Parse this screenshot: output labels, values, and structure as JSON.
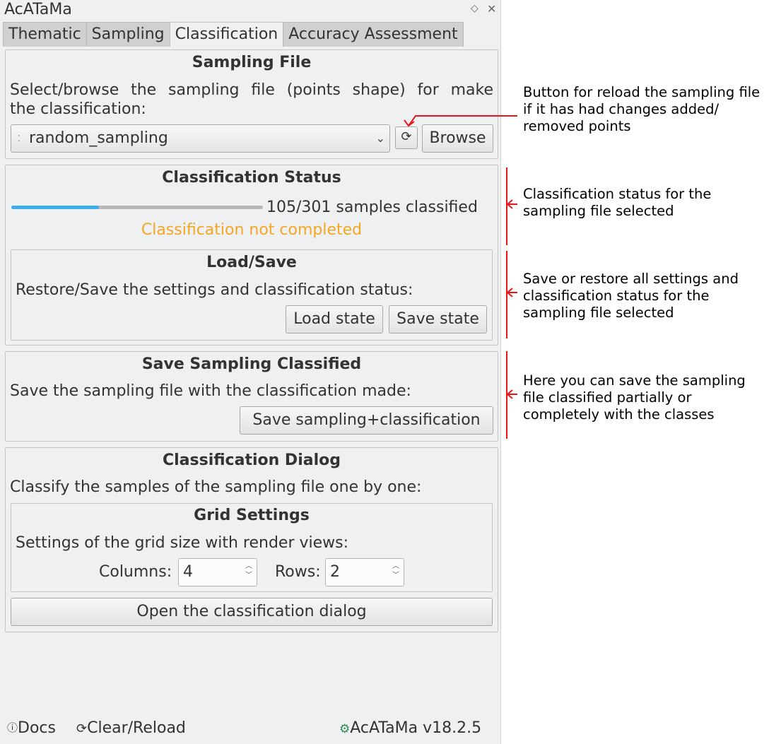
{
  "panel": {
    "title": "AcATaMa",
    "tabs": [
      "Thematic",
      "Sampling",
      "Classification",
      "Accuracy Assessment"
    ],
    "active_tab": "Classification"
  },
  "sampling_file": {
    "title": "Sampling File",
    "description_line1": "Select/browse the sampling file (points shape) for make",
    "description_line2": "the classification:",
    "selected_layer": "random_sampling",
    "browse_label": "Browse"
  },
  "status": {
    "title": "Classification Status",
    "progress_value": 105,
    "progress_total": 301,
    "progress_fraction": 0.349,
    "progress_text": "105/301 samples classified",
    "state_text": "Classification not completed",
    "state_color": "#f5a623",
    "progress_color": "#3daee9"
  },
  "load_save": {
    "title": "Load/Save",
    "description": "Restore/Save the settings and classification status:",
    "load_label": "Load state",
    "save_label": "Save state"
  },
  "save_classified": {
    "title": "Save Sampling Classified",
    "description": "Save the sampling file with the classification made:",
    "button_label": "Save sampling+classification"
  },
  "dialog": {
    "title": "Classification Dialog",
    "description": "Classify the samples of the sampling file one by one:",
    "grid_title": "Grid Settings",
    "grid_description": "Settings of the grid size with render views:",
    "columns_label": "Columns:",
    "columns_value": "4",
    "rows_label": "Rows:",
    "rows_value": "2",
    "open_label": "Open the classification dialog"
  },
  "footer": {
    "docs_label": "Docs",
    "clear_label": "Clear/Reload",
    "version_label": "AcATaMa v18.2.5"
  },
  "annotations": {
    "reload_line1": "Button for reload the sampling file",
    "reload_line2": "if it has had changes added/",
    "reload_line3": "removed points",
    "status_line1": "Classification status for the",
    "status_line2": "sampling file selected",
    "loadsave_line1": "Save or restore all settings and",
    "loadsave_line2": "classification status for the",
    "loadsave_line3": "sampling file selected",
    "saveclass_line1": "Here you can save the sampling",
    "saveclass_line2": "file classified partially or",
    "saveclass_line3": "completely with the classes",
    "annotation_color": "#e8161b"
  }
}
